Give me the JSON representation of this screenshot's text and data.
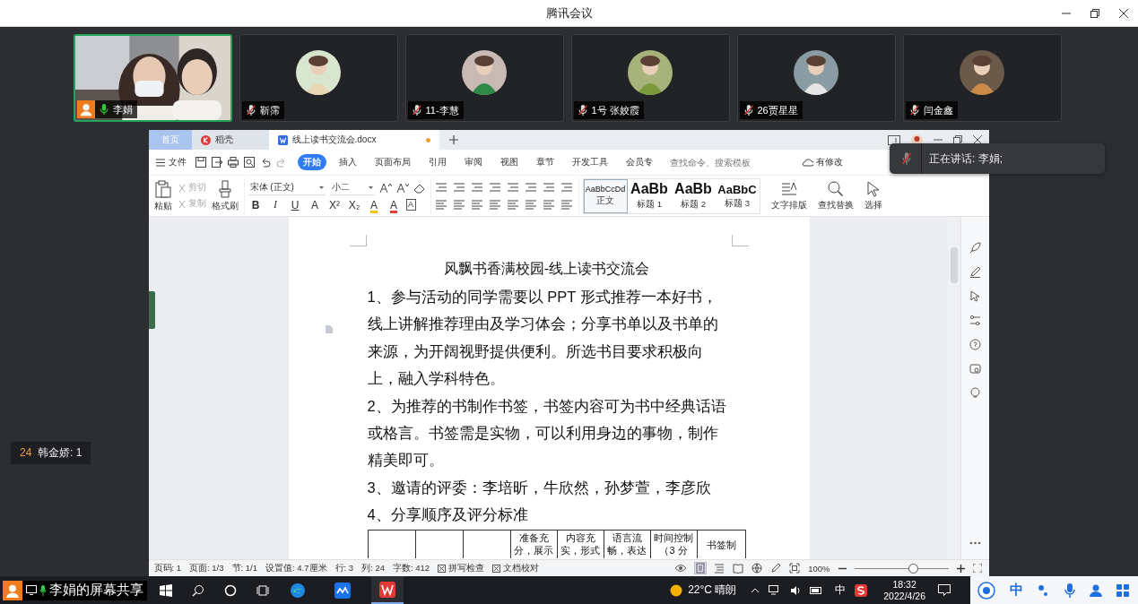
{
  "window": {
    "title": "腾讯会议"
  },
  "participants": [
    {
      "name": "李娟",
      "kind": "video",
      "host": true,
      "muted": false,
      "speaking": true
    },
    {
      "name": "靳霈",
      "kind": "avatar",
      "host": false,
      "muted": true,
      "speaking": false
    },
    {
      "name": "11-李慧",
      "kind": "avatar",
      "host": false,
      "muted": true,
      "speaking": false
    },
    {
      "name": "1号 张姣霞",
      "kind": "avatar",
      "host": false,
      "muted": true,
      "speaking": false
    },
    {
      "name": "26贾星星",
      "kind": "avatar",
      "host": false,
      "muted": true,
      "speaking": false
    },
    {
      "name": "闫金鑫",
      "kind": "avatar",
      "host": false,
      "muted": true,
      "speaking": false
    }
  ],
  "speaker_toast": {
    "label": "正在讲话: 李娟;",
    "muted": true
  },
  "side_badge": {
    "number": "24",
    "name": "韩金娇: 1"
  },
  "wps": {
    "tabs": [
      {
        "label": "首页",
        "kind": "home",
        "selected": false,
        "unsaved": false
      },
      {
        "label": "稻壳",
        "kind": "app",
        "selected": false,
        "unsaved": false
      },
      {
        "label": "线上读书交流会.docx",
        "kind": "doc",
        "selected": true,
        "unsaved": true
      }
    ],
    "file_menu": "文件",
    "ribbon_tabs": [
      {
        "label": "开始",
        "selected": true
      },
      {
        "label": "插入",
        "selected": false
      },
      {
        "label": "页面布局",
        "selected": false
      },
      {
        "label": "引用",
        "selected": false
      },
      {
        "label": "审阅",
        "selected": false
      },
      {
        "label": "视图",
        "selected": false
      },
      {
        "label": "章节",
        "selected": false
      },
      {
        "label": "开发工具",
        "selected": false
      },
      {
        "label": "会员专",
        "selected": false
      }
    ],
    "search_placeholder": "查找命令、搜索模板",
    "changes_label": "有修改",
    "paste": "粘贴",
    "small_tools": [
      {
        "label": "剪切",
        "disabled": true
      },
      {
        "label": "复制",
        "disabled": true
      }
    ],
    "format_painter": "格式刷",
    "font": {
      "name": "宋体 (正文)",
      "size": "小二"
    },
    "format_glyphs": [
      "B",
      "I",
      "U",
      "A",
      "X²",
      "X₂",
      "A",
      "A",
      "A"
    ],
    "styles": [
      {
        "preview": "AaBbCcDd",
        "label": "正文",
        "selected": true
      },
      {
        "preview": "AaBb",
        "label": "标题 1",
        "selected": false
      },
      {
        "preview": "AaBb",
        "label": "标题 2",
        "selected": false
      },
      {
        "preview": "AaBbC",
        "label": "标题 3",
        "selected": false
      }
    ],
    "big_tools": [
      "文字排版",
      "查找替换",
      "选择"
    ],
    "document": {
      "title": "风飘书香满校园-线上读书交流会",
      "paragraphs": [
        "1、参与活动的同学需要以 PPT 形式推荐一本好书，线上讲解推荐理由及学习体会；分享书单以及书单的来源，为开阔视野提供便利。所选书目要求积极向上，融入学科特色。",
        "2、为推荐的书制作书签，书签内容可为书中经典话语或格言。书签需是实物，可以利用身边的事物，制作精美即可。",
        "3、邀请的评委：李培昕，牛欣然，孙梦萱，李彦欣",
        "4、分享顺序及评分标准"
      ],
      "table_header": [
        "准备充分，展示",
        "内容充实，形式",
        "语言流畅，表达",
        "时间控制（3 分",
        "书签制"
      ]
    },
    "status": [
      "页码: 1",
      "页面: 1/3",
      "节: 1/1",
      "设置值: 4.7厘米",
      "行: 3",
      "列: 24",
      "字数: 412"
    ],
    "status_buttons": [
      "拼写检查",
      "文档校对"
    ],
    "zoom": {
      "label": "100%",
      "level": 0.62
    }
  },
  "taskbar": {
    "share_label": "李娟的屏幕共享",
    "weather": "22°C  晴朗",
    "ime": "中",
    "time": "18:32",
    "date": "2022/4/26",
    "ifly_ime": "中"
  }
}
